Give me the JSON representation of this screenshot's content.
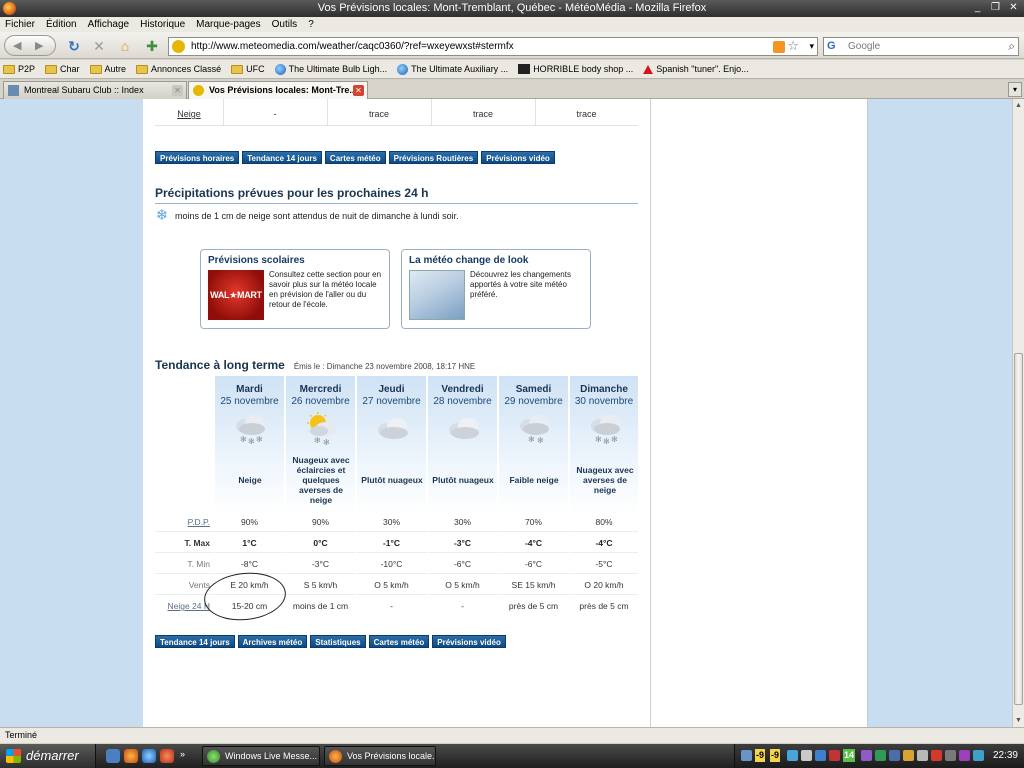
{
  "window": {
    "title": "Vos Prévisions locales: Mont-Tremblant, Québec - MétéoMédia - Mozilla Firefox"
  },
  "menu": [
    "Fichier",
    "Édition",
    "Affichage",
    "Historique",
    "Marque-pages",
    "Outils",
    "?"
  ],
  "nav": {
    "url": "http://www.meteomedia.com/weather/caqc0360/?ref=wxeyewxst#stermfx",
    "search_placeholder": "Google"
  },
  "bookmarks": [
    {
      "label": "P2P",
      "icon": "folder"
    },
    {
      "label": "Char",
      "icon": "folder"
    },
    {
      "label": "Autre",
      "icon": "folder"
    },
    {
      "label": "Annonces Classé",
      "icon": "folder"
    },
    {
      "label": "UFC",
      "icon": "folder"
    },
    {
      "label": "The Ultimate Bulb Ligh...",
      "icon": "globe"
    },
    {
      "label": "The Ultimate Auxiliary ...",
      "icon": "globe"
    },
    {
      "label": "HORRIBLE body shop ...",
      "icon": "site"
    },
    {
      "label": "Spanish \"tuner\". Enjo...",
      "icon": "mitsubishi"
    }
  ],
  "tabs": [
    {
      "label": "Montreal Subaru Club :: Index",
      "active": false
    },
    {
      "label": "Vos Prévisions locales: Mont-Tre...",
      "active": true
    }
  ],
  "snow_row": {
    "label": "Neige",
    "values": [
      "-",
      "trace",
      "trace",
      "trace"
    ]
  },
  "buttons_top": [
    "Prévisions horaires",
    "Tendance 14 jours",
    "Cartes météo",
    "Prévisions Routières",
    "Prévisions vidéo"
  ],
  "precip": {
    "heading": "Précipitations prévues pour les prochaines 24 h",
    "text": "moins de 1 cm de neige sont attendus de nuit de dimanche à lundi soir."
  },
  "promos": [
    {
      "title": "Prévisions scolaires",
      "image_text": "WAL★MART",
      "text": "Consultez cette section pour en savoir plus sur la météo locale en prévision de l'aller ou du retour de l'école."
    },
    {
      "title": "La météo change de look",
      "text": "Découvrez les changements apportés à votre site météo préféré."
    }
  ],
  "trend": {
    "heading": "Tendance à long terme",
    "issued": "Émis le : Dimanche 23 novembre 2008, 18:17 HNE",
    "row_labels": {
      "pdp": "P.D.P.",
      "tmax": "T. Max",
      "tmin": "T. Min",
      "winds": "Vents",
      "snow24": "Neige 24 H"
    },
    "days": [
      {
        "day": "Mardi",
        "date": "25 novembre",
        "icon": "snow-cloud-icon",
        "condition": "Neige",
        "pdp": "90%",
        "tmax": "1°C",
        "tmin": "-8°C",
        "wind": "E 20 km/h",
        "snow": "15-20 cm"
      },
      {
        "day": "Mercredi",
        "date": "26 novembre",
        "icon": "sun-snow-cloud-icon",
        "condition": "Nuageux avec éclaircies et quelques averses de neige",
        "pdp": "90%",
        "tmax": "0°C",
        "tmin": "-3°C",
        "wind": "S 5 km/h",
        "snow": "moins de 1 cm"
      },
      {
        "day": "Jeudi",
        "date": "27 novembre",
        "icon": "cloud-icon",
        "condition": "Plutôt nuageux",
        "pdp": "30%",
        "tmax": "-1°C",
        "tmin": "-10°C",
        "wind": "O 5 km/h",
        "snow": "-"
      },
      {
        "day": "Vendredi",
        "date": "28 novembre",
        "icon": "cloud-icon",
        "condition": "Plutôt nuageux",
        "pdp": "30%",
        "tmax": "-3°C",
        "tmin": "-6°C",
        "wind": "O 5 km/h",
        "snow": "-"
      },
      {
        "day": "Samedi",
        "date": "29 novembre",
        "icon": "snow-cloud-icon",
        "condition": "Faible neige",
        "pdp": "70%",
        "tmax": "-4°C",
        "tmin": "-6°C",
        "wind": "SE 15 km/h",
        "snow": "près de 5 cm"
      },
      {
        "day": "Dimanche",
        "date": "30 novembre",
        "icon": "snow-cloud-icon",
        "condition": "Nuageux avec averses de neige",
        "pdp": "80%",
        "tmax": "-4°C",
        "tmin": "-5°C",
        "wind": "O 20 km/h",
        "snow": "près de 5 cm"
      }
    ]
  },
  "buttons_bottom": [
    "Tendance 14 jours",
    "Archives météo",
    "Statistiques",
    "Cartes météo",
    "Prévisions vidéo"
  ],
  "status": "Terminé",
  "taskbar": {
    "start": "démarrer",
    "items": [
      "Windows Live Messe...",
      "Vos Prévisions locale..."
    ],
    "tray_numbers": [
      "-9",
      "-9",
      "14"
    ],
    "clock": "22:39"
  },
  "colors": {
    "accent": "#0d4a84",
    "page_bg": "#c9ddf1",
    "heading": "#1a3552"
  }
}
